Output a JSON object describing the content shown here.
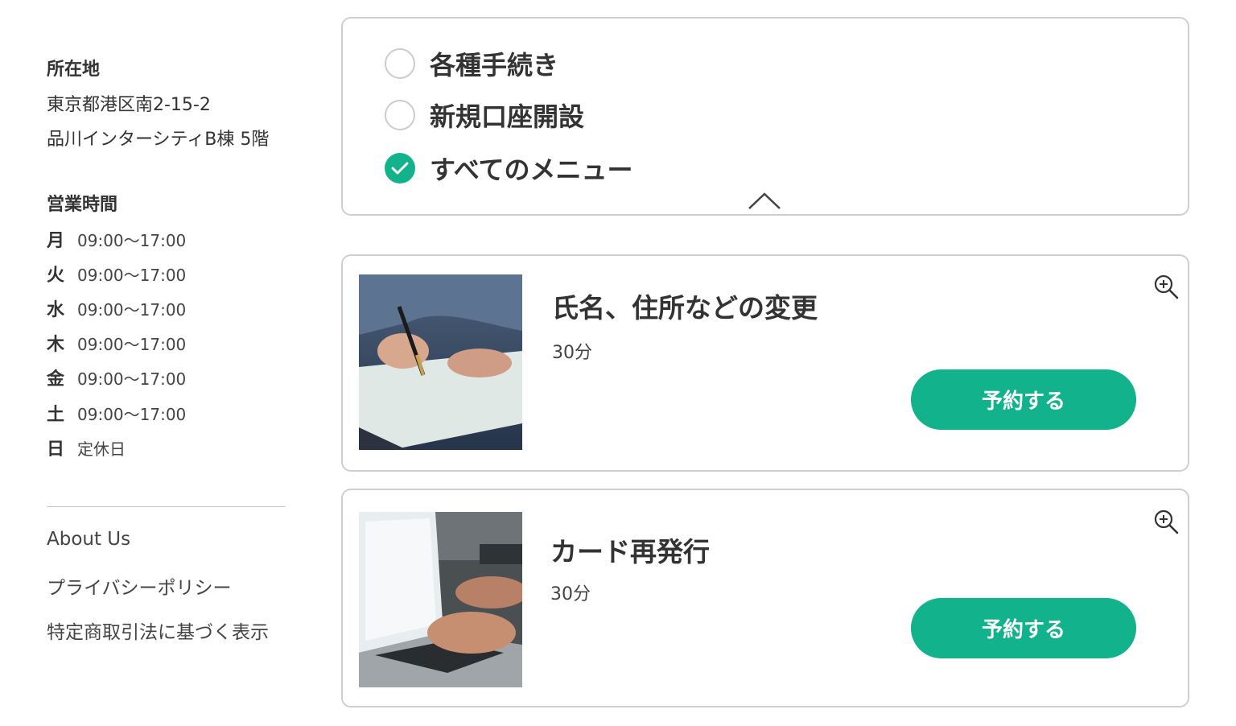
{
  "sidebar": {
    "location_title": "所在地",
    "address_line1": "東京都港区南2-15-2",
    "address_line2": "品川インターシティB棟 5階",
    "hours_title": "営業時間",
    "hours": [
      {
        "day": "月",
        "time": "09:00〜17:00"
      },
      {
        "day": "火",
        "time": "09:00〜17:00"
      },
      {
        "day": "水",
        "time": "09:00〜17:00"
      },
      {
        "day": "木",
        "time": "09:00〜17:00"
      },
      {
        "day": "金",
        "time": "09:00〜17:00"
      },
      {
        "day": "土",
        "time": "09:00〜17:00"
      },
      {
        "day": "日",
        "time": "定休日"
      }
    ],
    "links": [
      "About Us",
      "プライバシーポリシー",
      "特定商取引法に基づく表示"
    ]
  },
  "filter": {
    "options": [
      {
        "label": "各種手続き",
        "checked": false
      },
      {
        "label": "新規口座開設",
        "checked": false
      },
      {
        "label": "すべてのメニュー",
        "checked": true
      }
    ],
    "collapse_icon": "chevron-up-icon"
  },
  "services": [
    {
      "title": "氏名、住所などの変更",
      "duration": "30分",
      "button": "予約する",
      "image": "signing-document-photo"
    },
    {
      "title": "カード再発行",
      "duration": "30分",
      "button": "予約する",
      "image": "laptop-typing-photo"
    }
  ],
  "colors": {
    "accent": "#12b28c",
    "border": "#cfcfcf",
    "text": "#333333"
  }
}
